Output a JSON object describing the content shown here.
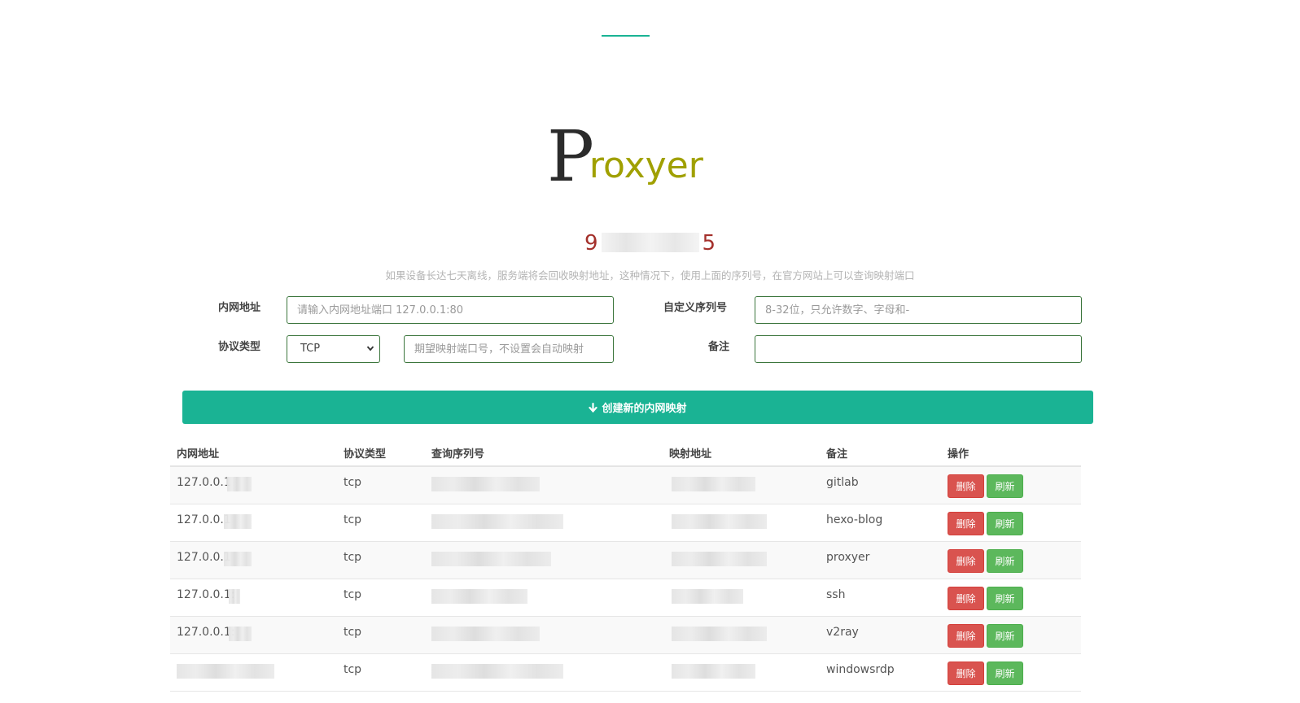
{
  "logo": {
    "first_letter": "P",
    "rest": "roxyer"
  },
  "serial": {
    "prefix": "9",
    "suffix": "5"
  },
  "notice": "如果设备长达七天离线，服务端将会回收映射地址，这种情况下，使用上面的序列号，在官方网站上可以查询映射端口",
  "form": {
    "inner_address_label": "内网地址",
    "inner_address_placeholder": "请输入内网地址端口 127.0.0.1:80",
    "serial_label": "自定义序列号",
    "serial_placeholder": "8-32位，只允许数字、字母和-",
    "protocol_label": "协议类型",
    "protocol_value": "TCP",
    "port_placeholder": "期望映射端口号，不设置会自动映射",
    "remark_label": "备注",
    "remark_value": ""
  },
  "create_button": {
    "label": "创建新的内网映射",
    "icon": "arrow-down-icon"
  },
  "table": {
    "headers": [
      "内网地址",
      "协议类型",
      "查询序列号",
      "映射地址",
      "备注",
      "操作"
    ],
    "rows": [
      {
        "address": "127.0.0.1",
        "protocol": "tcp",
        "remark": "gitlab"
      },
      {
        "address": "127.0.0.1",
        "protocol": "tcp",
        "remark": "hexo-blog"
      },
      {
        "address": "127.0.0.1",
        "protocol": "tcp",
        "remark": "proxyer"
      },
      {
        "address": "127.0.0.1:",
        "protocol": "tcp",
        "remark": "ssh"
      },
      {
        "address": "127.0.0.1:",
        "protocol": "tcp",
        "remark": "v2ray"
      },
      {
        "address": "",
        "protocol": "tcp",
        "remark": "windowsrdp"
      }
    ],
    "delete_label": "删除",
    "refresh_label": "刷新"
  },
  "colors": {
    "accent": "#1ab394",
    "danger": "#d9534f",
    "success": "#5cb85c",
    "serial": "#a4302b",
    "logo_letters": "#a0a000"
  }
}
